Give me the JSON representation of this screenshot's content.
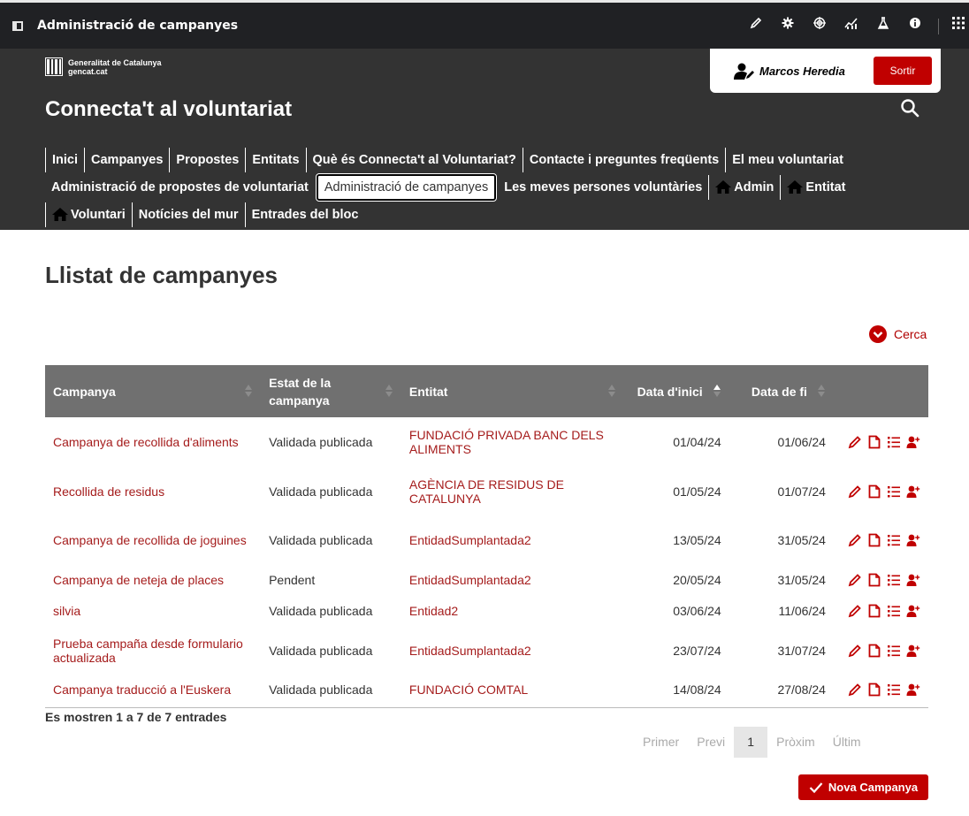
{
  "appbar": {
    "title": "Administració de campanyes",
    "tools": [
      "pencil-icon",
      "gear-icon",
      "target-icon",
      "chart-icon",
      "flask-icon",
      "info-icon",
      "apps-grid-icon"
    ]
  },
  "header": {
    "logo_line1": "Generalitat de Catalunya",
    "logo_line2": "gencat.cat",
    "site_title": "Connecta't al voluntariat",
    "user_name": "Marcos Heredia",
    "logout_label": "Sortir"
  },
  "nav": {
    "row1": [
      "Inici",
      "Campanyes",
      "Propostes",
      "Entitats",
      "Què és Connecta't al Voluntariat?",
      "Contacte i preguntes freqüents",
      "El meu voluntariat"
    ],
    "row2": [
      "Administració de propostes de voluntariat",
      "Administració de campanyes",
      "Les meves persones voluntàries",
      "Admin",
      "Entitat"
    ],
    "row3": [
      "Voluntari",
      "Notícies del mur",
      "Entrades del bloc"
    ]
  },
  "main": {
    "title": "Llistat de campanyes",
    "search_toggle": "Cerca",
    "columns": [
      "Campanya",
      "Estat de la campanya",
      "Entitat",
      "Data d'inici",
      "Data de fi"
    ],
    "rows": [
      {
        "campaign": "Campanya de recollida d'aliments",
        "status": "Validada publicada",
        "entity": "FUNDACIÓ PRIVADA BANC DELS ALIMENTS",
        "start": "01/04/24",
        "end": "01/06/24"
      },
      {
        "campaign": "Recollida de residus",
        "status": "Validada publicada",
        "entity": "AGÈNCIA DE RESIDUS DE CATALUNYA",
        "start": "01/05/24",
        "end": "01/07/24"
      },
      {
        "campaign": "Campanya de recollida de joguines",
        "status": "Validada publicada",
        "entity": "EntidadSumplantada2",
        "start": "13/05/24",
        "end": "31/05/24"
      },
      {
        "campaign": "Campanya de neteja de places",
        "status": "Pendent",
        "entity": "EntidadSumplantada2",
        "start": "20/05/24",
        "end": "31/05/24"
      },
      {
        "campaign": "silvia",
        "status": "Validada publicada",
        "entity": "Entidad2",
        "start": "03/06/24",
        "end": "11/06/24"
      },
      {
        "campaign": "Prueba campaña desde formulario actualizada",
        "status": "Validada publicada",
        "entity": "EntidadSumplantada2",
        "start": "23/07/24",
        "end": "31/07/24"
      },
      {
        "campaign": "Campanya traducció a l'Euskera",
        "status": "Validada publicada",
        "entity": "FUNDACIÓ COMTAL",
        "start": "14/08/24",
        "end": "27/08/24"
      }
    ],
    "info": "Es mostren 1 a 7 de 7 entrades",
    "pager": {
      "first": "Primer",
      "prev": "Previ",
      "current": "1",
      "next": "Pròxim",
      "last": "Últim"
    },
    "new_button": "Nova Campanya"
  },
  "colors": {
    "accent": "#c00000",
    "link": "#a51c1c",
    "header_bg": "#333333",
    "table_head": "#707070"
  }
}
